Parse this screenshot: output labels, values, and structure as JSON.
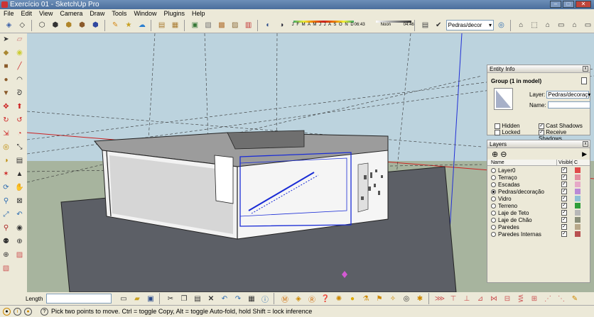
{
  "window": {
    "title": "Exercício 01 - SketchUp Pro"
  },
  "menu": [
    "File",
    "Edit",
    "View",
    "Camera",
    "Draw",
    "Tools",
    "Window",
    "Plugins",
    "Help"
  ],
  "shadow": {
    "months": "J F M A M J J A S O N D",
    "time_start": "06:43",
    "noon": "Noon",
    "time_end": "04:46"
  },
  "layer_dropdown": {
    "value": "Pedras/decor"
  },
  "entity_info": {
    "title": "Entity Info",
    "selection": "Group (1 in model)",
    "layer_label": "Layer:",
    "layer_value": "Pedras/decoraç",
    "name_label": "Name:",
    "name_value": "",
    "hidden_label": "Hidden",
    "locked_label": "Locked",
    "cast_shadows_label": "Cast Shadows",
    "receive_shadows_label": "Receive Shadows"
  },
  "layers_panel": {
    "title": "Layers",
    "col_name": "Name",
    "col_visible": "Visible",
    "col_color": "C",
    "rows": [
      {
        "name": "Layer0",
        "active": false,
        "visible": true,
        "color": "#e04a4a"
      },
      {
        "name": "Terraço",
        "active": false,
        "visible": true,
        "color": "#e28fa0"
      },
      {
        "name": "Escadas",
        "active": false,
        "visible": true,
        "color": "#e6a9c7"
      },
      {
        "name": "Pedras/decoração",
        "active": true,
        "visible": true,
        "color": "#b98ad6"
      },
      {
        "name": "Vidro",
        "active": false,
        "visible": true,
        "color": "#8fc1d6"
      },
      {
        "name": "Terreno",
        "active": false,
        "visible": true,
        "color": "#2f9e3a"
      },
      {
        "name": "Laje de Teto",
        "active": false,
        "visible": true,
        "color": "#b8b8b8"
      },
      {
        "name": "Laje de Chão",
        "active": false,
        "visible": true,
        "color": "#8a8f7a"
      },
      {
        "name": "Paredes",
        "active": false,
        "visible": true,
        "color": "#b8a88a"
      },
      {
        "name": "Paredes Internas",
        "active": false,
        "visible": true,
        "color": "#b85050"
      }
    ]
  },
  "measurements": {
    "label": "Length",
    "value": ""
  },
  "status": {
    "message": "Pick two points to move.  Ctrl = toggle Copy, Alt = toggle Auto-fold, hold Shift = lock inference"
  },
  "colors": {
    "sky": "#bcd3de",
    "ground": "#a7b49e",
    "terrain": "#5c5f66",
    "selection": "#1a2cd6"
  }
}
